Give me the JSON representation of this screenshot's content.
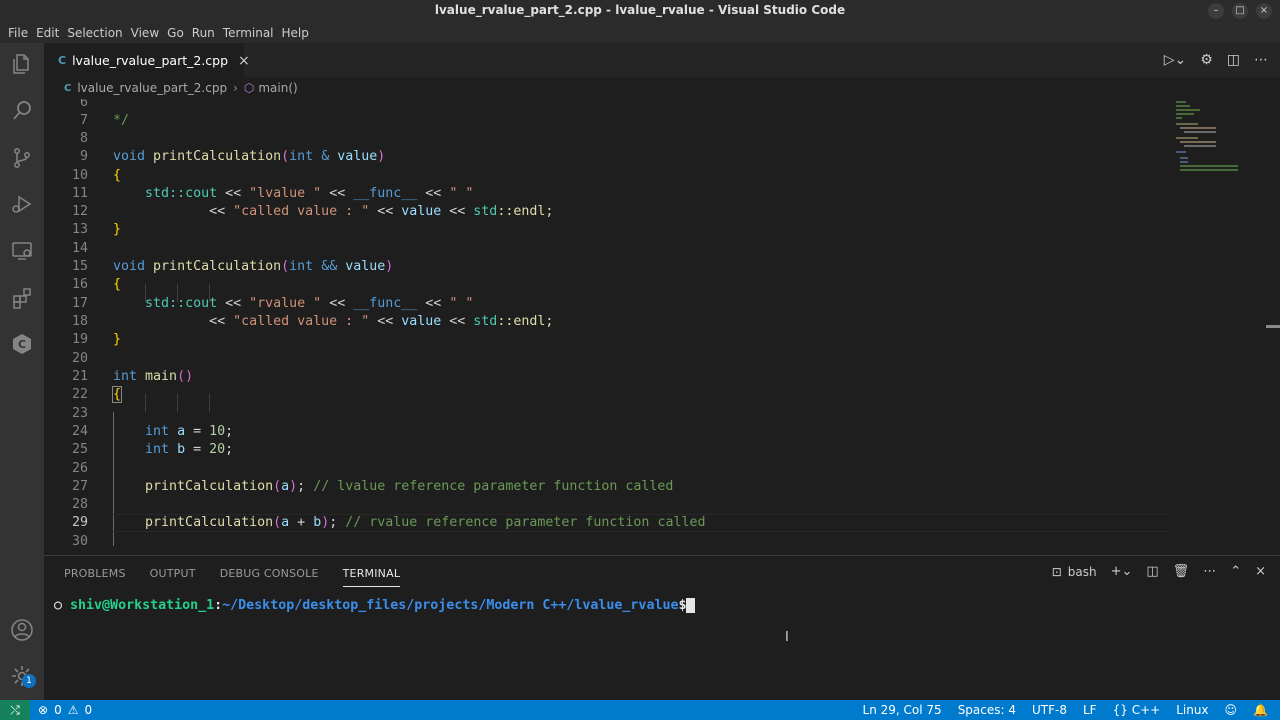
{
  "window": {
    "title": "lvalue_rvalue_part_2.cpp - lvalue_rvalue - Visual Studio Code"
  },
  "menu": [
    "File",
    "Edit",
    "Selection",
    "View",
    "Go",
    "Run",
    "Terminal",
    "Help"
  ],
  "tab": {
    "filename": "lvalue_rvalue_part_2.cpp",
    "icon": "C",
    "close": "×"
  },
  "breadcrumb": {
    "file": "lvalue_rvalue_part_2.cpp",
    "separator": "›",
    "symbol": "main()"
  },
  "editor": {
    "current_line": 29,
    "lines": [
      {
        "n": "6"
      },
      {
        "n": "7"
      },
      {
        "n": "8"
      },
      {
        "n": "9"
      },
      {
        "n": "10"
      },
      {
        "n": "11"
      },
      {
        "n": "12"
      },
      {
        "n": "13"
      },
      {
        "n": "14"
      },
      {
        "n": "15"
      },
      {
        "n": "16"
      },
      {
        "n": "17"
      },
      {
        "n": "18"
      },
      {
        "n": "19"
      },
      {
        "n": "20"
      },
      {
        "n": "21"
      },
      {
        "n": "22"
      },
      {
        "n": "23"
      },
      {
        "n": "24"
      },
      {
        "n": "25"
      },
      {
        "n": "26"
      },
      {
        "n": "27"
      },
      {
        "n": "28"
      },
      {
        "n": "29"
      },
      {
        "n": "30"
      }
    ],
    "code": {
      "l7": "*/",
      "l9_void": "void",
      "l9_fn": "printCalculation",
      "l9_paren": "(",
      "l9_int": "int",
      "l9_amp": " & ",
      "l9_param": "value",
      "l9_close": ")",
      "l10_brace": "{",
      "l11_ns": "std",
      "l11_cout": "::cout",
      "l11_op1": " << ",
      "l11_str1": "\"lvalue \"",
      "l11_op2": " << ",
      "l11_func": "__func__",
      "l11_op3": " << ",
      "l11_str2": "\" \"",
      "l12_op1": "<< ",
      "l12_str": "\"called value : \"",
      "l12_op2": " << ",
      "l12_val": "value",
      "l12_op3": " << ",
      "l12_ns": "std",
      "l12_endl": "::endl;",
      "l13_brace": "}",
      "l15_void": "void",
      "l15_fn": "printCalculation",
      "l15_paren": "(",
      "l15_int": "int",
      "l15_amp": " && ",
      "l15_param": "value",
      "l15_close": ")",
      "l16_brace": "{",
      "l17_ns": "std",
      "l17_cout": "::cout",
      "l17_op1": " << ",
      "l17_str1": "\"rvalue \"",
      "l17_op2": " << ",
      "l17_func": "__func__",
      "l17_op3": " << ",
      "l17_str2": "\" \"",
      "l18_op1": "<< ",
      "l18_str": "\"called value : \"",
      "l18_op2": " << ",
      "l18_val": "value",
      "l18_op3": " << ",
      "l18_ns": "std",
      "l18_endl": "::endl;",
      "l19_brace": "}",
      "l21_int": "int",
      "l21_fn": " main",
      "l21_paren": "()",
      "l22_brace": "{",
      "l24_int": "int",
      "l24_var": " a",
      "l24_eq": " = ",
      "l24_num": "10",
      "l24_semi": ";",
      "l25_int": "int",
      "l25_var": " b",
      "l25_eq": " = ",
      "l25_num": "20",
      "l25_semi": ";",
      "l27_fn": "printCalculation",
      "l27_open": "(",
      "l27_arg": "a",
      "l27_close": ")",
      "l27_semi": "; ",
      "l27_cm": "// lvalue reference parameter function called",
      "l29_fn": "printCalculation",
      "l29_open": "(",
      "l29_arg1": "a",
      "l29_plus": " + ",
      "l29_arg2": "b",
      "l29_close": ")",
      "l29_semi": "; ",
      "l29_cm": "// rvalue reference parameter function called"
    }
  },
  "panel": {
    "tabs": [
      "PROBLEMS",
      "OUTPUT",
      "DEBUG CONSOLE",
      "TERMINAL"
    ],
    "active_tab": "TERMINAL",
    "shell": "bash",
    "terminal": {
      "bullet": "○",
      "user": "shiv@Workstation_1",
      "colon": ":",
      "path": "~/Desktop/desktop_files/projects/Modern C++/lvalue_rvalue",
      "prompt": "$"
    }
  },
  "statusbar": {
    "errors": "0",
    "warnings": "0",
    "position": "Ln 29, Col 75",
    "spaces": "Spaces: 4",
    "encoding": "UTF-8",
    "eol": "LF",
    "language": "C++",
    "platform": "Linux"
  },
  "accounts_badge": "1",
  "colors": {
    "statusbar": "#007acc",
    "activitybar": "#333333",
    "editor_bg": "#1e1e1e"
  }
}
